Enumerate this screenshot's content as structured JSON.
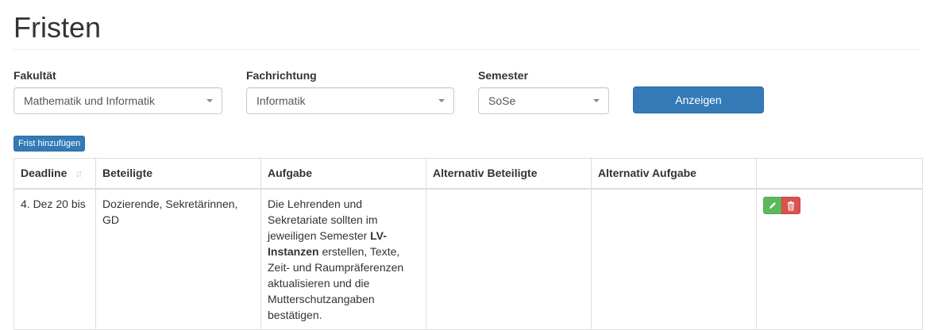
{
  "page": {
    "title": "Fristen"
  },
  "filters": {
    "faculty": {
      "label": "Fakultät",
      "value": "Mathematik und Informatik"
    },
    "field": {
      "label": "Fachrichtung",
      "value": "Informatik"
    },
    "semester": {
      "label": "Semester",
      "value": "SoSe"
    },
    "show_button": "Anzeigen"
  },
  "add_button": "Frist hinzufügen",
  "table": {
    "headers": [
      "Deadline",
      "Beteiligte",
      "Aufgabe",
      "Alternativ Beteiligte",
      "Alternativ Aufgabe",
      ""
    ],
    "rows": [
      {
        "deadline": "4. Dez 20 bis",
        "participants": "Dozierende, Sekretärinnen, GD",
        "task_before": "Die Lehrenden und Sekretariate sollten im jeweiligen Semester ",
        "task_bold": "LV-Instanzen",
        "task_after": " erstellen, Texte, Zeit- und Raumpräferenzen aktualisieren und die Mutterschutzangaben bestätigen.",
        "alt_participants": "",
        "alt_task": ""
      }
    ]
  },
  "colors": {
    "primary": "#337ab7",
    "success": "#5cb85c",
    "danger": "#d9534f"
  },
  "icons": [
    "sort-icon",
    "pencil-icon",
    "trash-icon",
    "caret-down-icon"
  ]
}
